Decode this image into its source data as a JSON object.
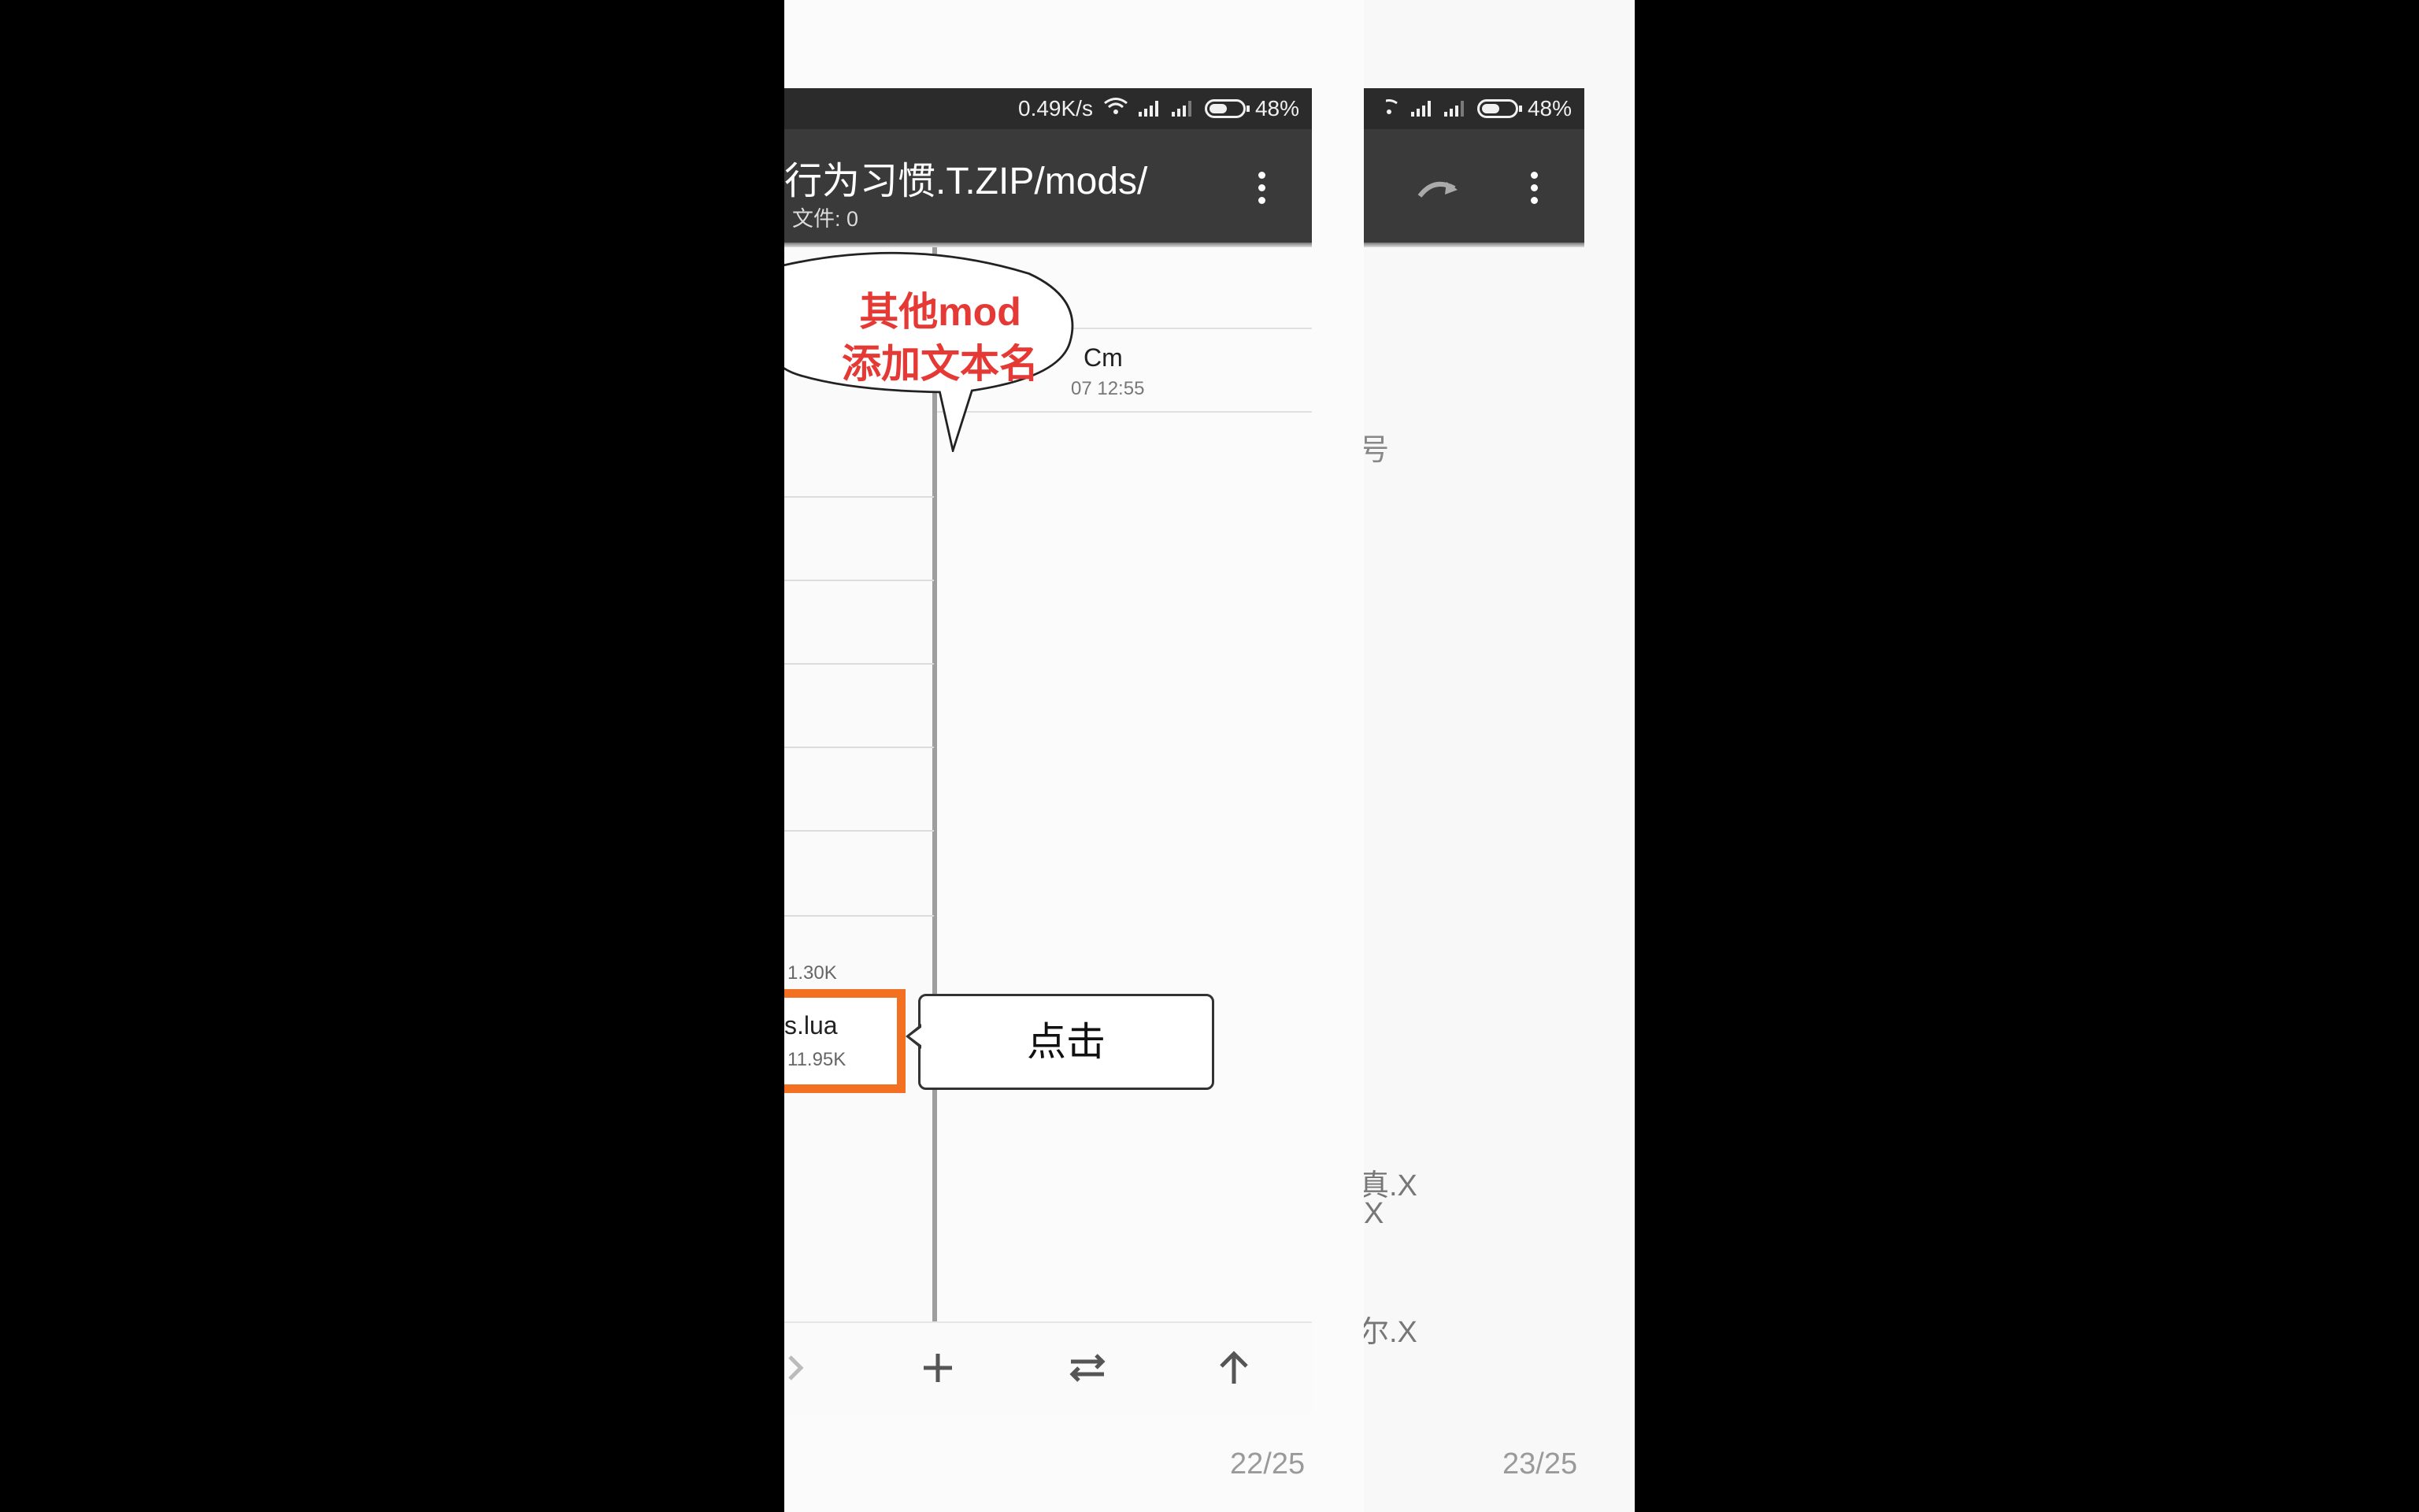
{
  "slide22": {
    "status": {
      "speed": "0.49K/s",
      "battery": "48%"
    },
    "toolbar": {
      "path": "行为习惯.T.ZIP/mods/",
      "files": "文件: 0"
    },
    "bubble_lines": [
      "其他mod",
      "添加文本名"
    ],
    "right_item": {
      "name": "Cm",
      "date": "07 12:55"
    },
    "left_items": [
      {
        "meta": "1.30K"
      },
      {
        "name": "s.lua",
        "meta": "11.95K"
      }
    ],
    "callout": "点击",
    "page_number": "22/25"
  },
  "slide23": {
    "status": {
      "battery": "48%"
    },
    "fragments": [
      "号",
      "真.X",
      "X",
      "尔.X"
    ],
    "page_number": "23/25"
  },
  "colors": {
    "bubble_text": "#e53935",
    "highlight": "#f36f21",
    "toolbar": "#3a3a3a",
    "statusbar": "#2b2b2b"
  }
}
